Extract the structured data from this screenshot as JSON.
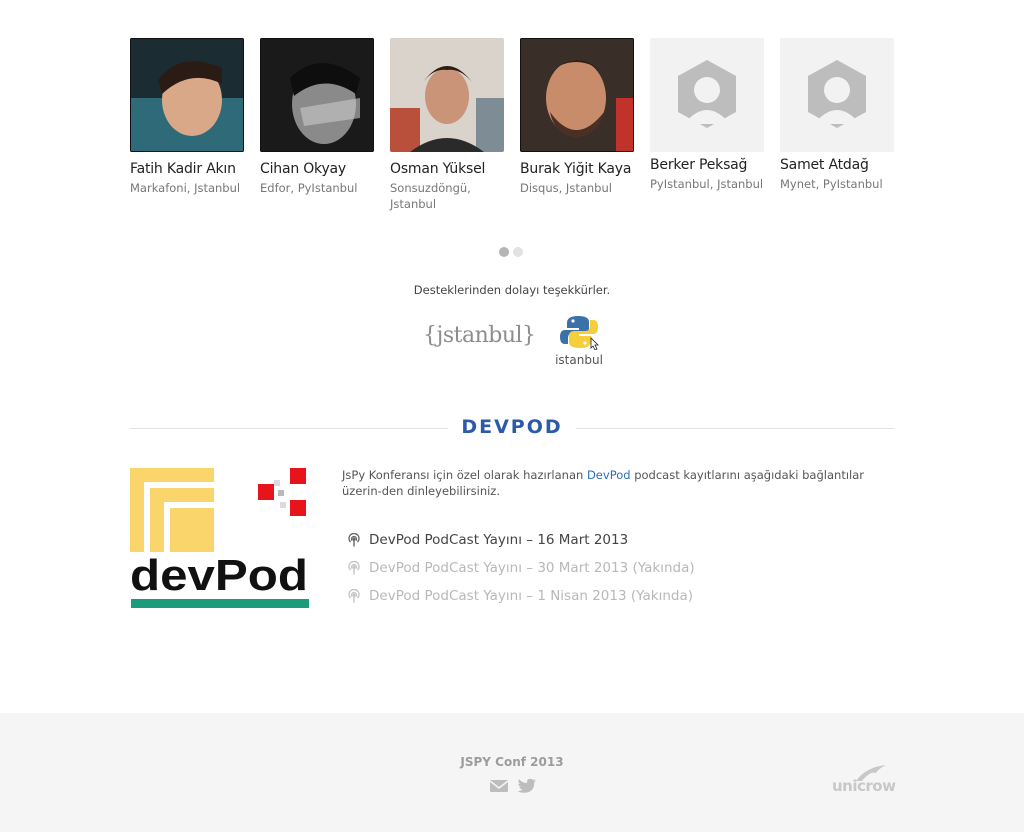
{
  "speakers": [
    {
      "name": "Fatih Kadir Akın",
      "affiliation": "Markafoni, Jstanbul"
    },
    {
      "name": "Cihan Okyay",
      "affiliation": "Edfor, PyIstanbul"
    },
    {
      "name": "Osman Yüksel",
      "affiliation": "Sonsuzdöngü, Jstanbul"
    },
    {
      "name": "Burak Yiğit Kaya",
      "affiliation": "Disqus, Jstanbul"
    },
    {
      "name": "Berker Peksağ",
      "affiliation": "PyIstanbul, Jstanbul"
    },
    {
      "name": "Samet Atdağ",
      "affiliation": "Mynet, PyIstanbul"
    }
  ],
  "carousel": {
    "pages": 2,
    "active": 1
  },
  "sponsors": {
    "thanks_text": "Desteklerinden dolayı teşekkürler.",
    "jstanbul_label": "{jstanbul}",
    "pyistanbul_label": "istanbul"
  },
  "devpod": {
    "title": "DEVPOD",
    "logo_text": "devPod",
    "intro_before": "JsPy Konferansı için özel olarak hazırlanan ",
    "intro_link": "DevPod",
    "intro_after": " podcast kayıtlarını aşağıdaki bağlantılar üzerin-den dinleyebilirsiniz.",
    "episodes": [
      {
        "label": "DevPod PodCast Yayını – 16 Mart 2013",
        "available": true
      },
      {
        "label": "DevPod PodCast Yayını – 30 Mart 2013 (Yakında)",
        "available": false
      },
      {
        "label": "DevPod PodCast Yayını – 1 Nisan 2013 (Yakında)",
        "available": false
      }
    ]
  },
  "footer": {
    "title": "JSPY Conf 2013",
    "icons": [
      "mail-icon",
      "twitter-icon"
    ],
    "brand": "unicrow"
  },
  "colors": {
    "accent": "#2c5aa8",
    "link": "#2c6fb8",
    "footer_bg": "#f5f5f5",
    "devpod_yellow": "#f9d56c",
    "devpod_red": "#e8141c",
    "devpod_green": "#1a9c7c"
  }
}
